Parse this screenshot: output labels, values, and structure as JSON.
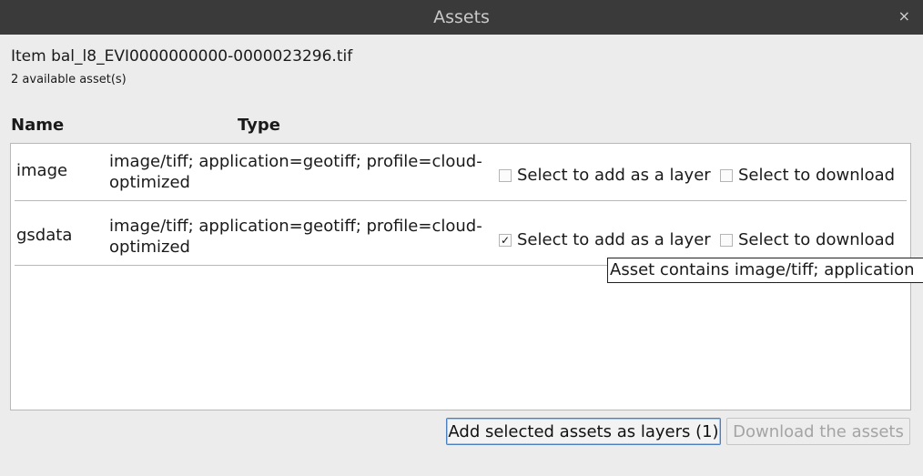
{
  "window": {
    "title": "Assets",
    "close_glyph": "×"
  },
  "item": {
    "title": "Item bal_l8_EVI0000000000-0000023296.tif",
    "asset_count": "2 available asset(s)"
  },
  "table": {
    "headers": {
      "name": "Name",
      "type": "Type"
    },
    "rows": [
      {
        "name": "image",
        "type_line1": "image/tiff; application=geotiff; profile=cloud-",
        "type_line2": "optimized",
        "layer_label": "Select to add as a layer",
        "layer_checked": false,
        "layer_mark": "",
        "download_label": "Select to download",
        "download_checked": false,
        "download_mark": ""
      },
      {
        "name": "gsdata",
        "type_line1": "image/tiff; application=geotiff; profile=cloud-",
        "type_line2": "optimized",
        "layer_label": "Select to add as a layer",
        "layer_checked": true,
        "layer_mark": "✓",
        "download_label": "Select to download",
        "download_checked": false,
        "download_mark": ""
      }
    ]
  },
  "tooltip": {
    "text": "Asset contains image/tiff; application"
  },
  "buttons": {
    "add_layers": "Add selected assets as layers (1)",
    "download": "Download the assets"
  },
  "colors": {
    "titlebar": "#3a3a3a",
    "focus_border": "#4a7fc0",
    "disabled_text": "#a4a4a4"
  }
}
